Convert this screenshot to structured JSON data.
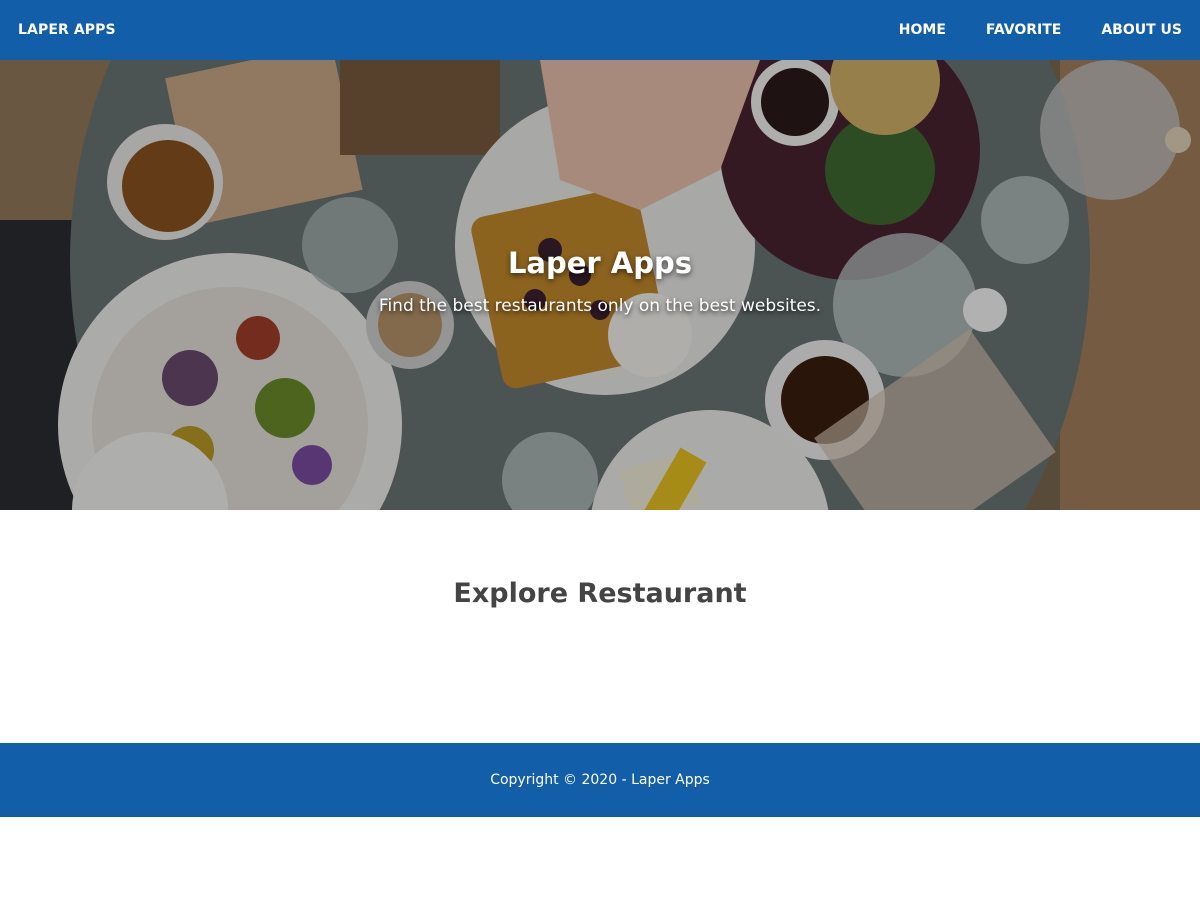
{
  "nav": {
    "brand": "LAPER APPS",
    "links": [
      "HOME",
      "FAVORITE",
      "ABOUT US"
    ]
  },
  "hero": {
    "title": "Laper Apps",
    "subtitle": "Find the best restaurants only on the best websites."
  },
  "main": {
    "section_title": "Explore Restaurant"
  },
  "footer": {
    "copyright": "Copyright © 2020 - Laper Apps"
  },
  "colors": {
    "brand_blue": "#125ea9",
    "text_dark": "#444444",
    "white": "#ffffff"
  }
}
